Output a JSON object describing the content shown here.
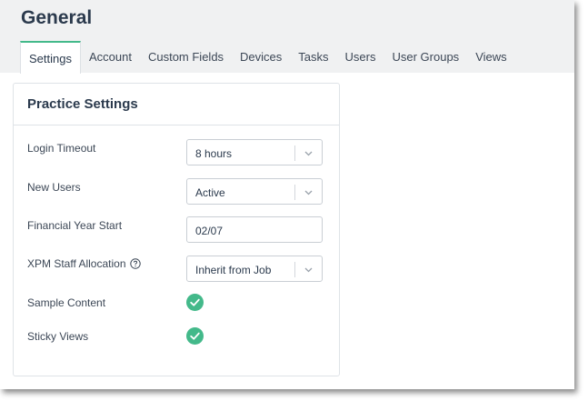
{
  "header": {
    "title": "General"
  },
  "tabs": [
    {
      "label": "Settings",
      "active": true
    },
    {
      "label": "Account"
    },
    {
      "label": "Custom Fields"
    },
    {
      "label": "Devices"
    },
    {
      "label": "Tasks"
    },
    {
      "label": "Users"
    },
    {
      "label": "User Groups"
    },
    {
      "label": "Views"
    }
  ],
  "panel": {
    "title": "Practice Settings",
    "fields": {
      "login_timeout": {
        "label": "Login Timeout",
        "value": "8 hours"
      },
      "new_users": {
        "label": "New Users",
        "value": "Active"
      },
      "financial_year_start": {
        "label": "Financial Year Start",
        "value": "02/07"
      },
      "xpm_staff_allocation": {
        "label": "XPM Staff Allocation",
        "value": "Inherit from Job",
        "icon": "help-icon"
      },
      "sample_content": {
        "label": "Sample Content",
        "checked": true
      },
      "sticky_views": {
        "label": "Sticky Views",
        "checked": true
      }
    }
  },
  "colors": {
    "accent": "#43b98a",
    "title": "#2b3a4d",
    "topbar": "#f0f1f2"
  }
}
